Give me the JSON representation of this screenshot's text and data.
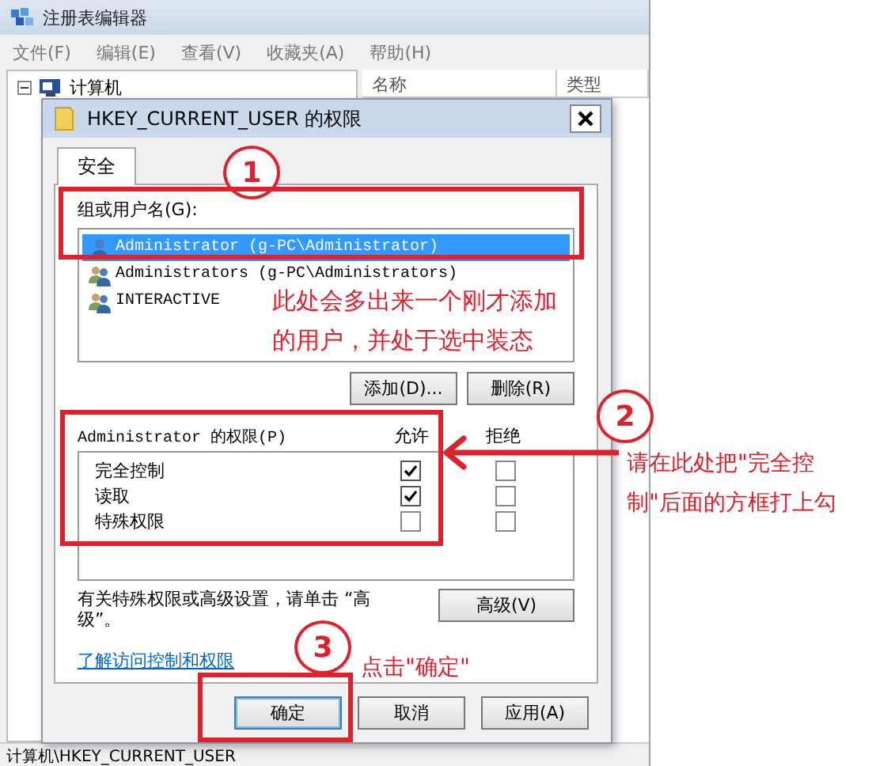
{
  "window": {
    "title": "注册表编辑器"
  },
  "menu": [
    "文件(F)",
    "编辑(E)",
    "查看(V)",
    "收藏夹(A)",
    "帮助(H)"
  ],
  "tree": {
    "label": "计算机",
    "expanded": true
  },
  "list_columns": [
    "名称",
    "类型"
  ],
  "status_bar": "计算机\\HKEY_CURRENT_USER",
  "dialog": {
    "title": "HKEY_CURRENT_USER 的权限",
    "tabs": [
      {
        "label": "安全",
        "selected": true
      }
    ],
    "users_label": "组或用户名(G):",
    "users": [
      {
        "name": "Administrator (g-PC\\Administrator)",
        "selected": true,
        "kind": "user"
      },
      {
        "name": "Administrators (g-PC\\Administrators)",
        "selected": false,
        "kind": "group"
      },
      {
        "name": "INTERACTIVE",
        "selected": false,
        "kind": "group"
      }
    ],
    "user_buttons": [
      "添加(D)...",
      "删除(R)"
    ],
    "permissions_label": "Administrator 的权限(P)",
    "allow_header": "允许",
    "deny_header": "拒绝",
    "permissions": [
      {
        "name": "完全控制",
        "allow": true,
        "deny": false
      },
      {
        "name": "读取",
        "allow": true,
        "deny": false
      },
      {
        "name": "特殊权限",
        "allow": false,
        "deny": false
      }
    ],
    "advanced_note": "有关特殊权限或高级设置，请单击 “高级”。",
    "advanced_button": "高级(V)",
    "link": "了解访问控制和权限",
    "buttons": [
      "确定",
      "取消",
      "应用(A)"
    ]
  },
  "annotations": [
    {
      "number": "1",
      "text": "此处会多出来一个刚才添加的用户，并处于选中装态"
    },
    {
      "number": "2",
      "text": "请在此处把\"完全控制\"后面的方框打上勾"
    },
    {
      "number": "3",
      "text": "点击\"确定\""
    }
  ]
}
